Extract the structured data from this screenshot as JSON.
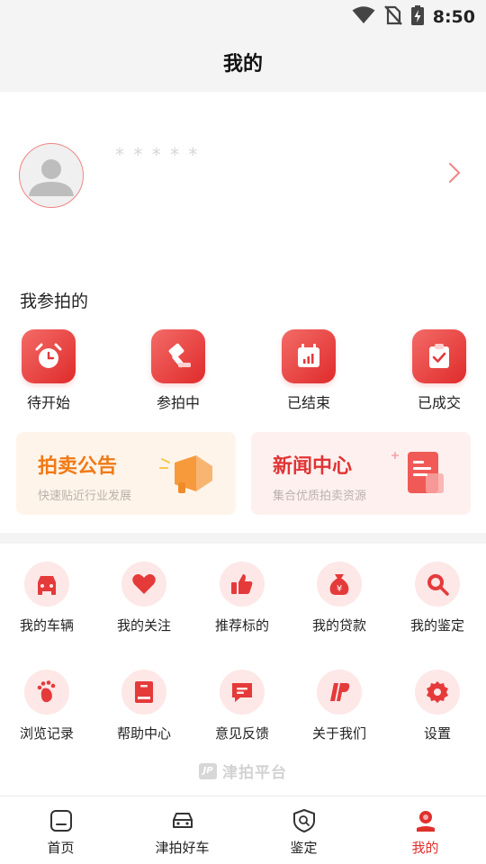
{
  "status_bar": {
    "time": "8:50"
  },
  "header": {
    "title": "我的"
  },
  "profile": {
    "username": "* * * * *"
  },
  "auction": {
    "section_title": "我参拍的",
    "statuses": [
      {
        "label": "待开始",
        "icon": "alarm-clock-icon"
      },
      {
        "label": "参拍中",
        "icon": "gavel-icon"
      },
      {
        "label": "已结束",
        "icon": "calendar-chart-icon"
      },
      {
        "label": "已成交",
        "icon": "clipboard-check-icon"
      }
    ]
  },
  "promos": [
    {
      "title": "拍卖公告",
      "subtitle": "快速贴近行业发展",
      "icon": "megaphone-icon"
    },
    {
      "title": "新闻中心",
      "subtitle": "集合优质拍卖资源",
      "icon": "newspaper-icon"
    }
  ],
  "menu": [
    {
      "label": "我的车辆",
      "icon": "car-icon"
    },
    {
      "label": "我的关注",
      "icon": "heart-icon"
    },
    {
      "label": "推荐标的",
      "icon": "thumbs-up-icon"
    },
    {
      "label": "我的贷款",
      "icon": "money-bag-icon"
    },
    {
      "label": "我的鉴定",
      "icon": "magnifier-icon"
    },
    {
      "label": "浏览记录",
      "icon": "footprint-icon"
    },
    {
      "label": "帮助中心",
      "icon": "book-icon"
    },
    {
      "label": "意见反馈",
      "icon": "chat-bubble-icon"
    },
    {
      "label": "关于我们",
      "icon": "brand-logo-icon"
    },
    {
      "label": "设置",
      "icon": "gear-icon"
    }
  ],
  "watermark": {
    "logo": "JP",
    "text": "津拍平台"
  },
  "tabs": [
    {
      "label": "首页",
      "icon": "home-icon"
    },
    {
      "label": "津拍好车",
      "icon": "car-outline-icon"
    },
    {
      "label": "鉴定",
      "icon": "shield-search-icon"
    },
    {
      "label": "我的",
      "icon": "user-icon",
      "active": true
    }
  ],
  "colors": {
    "accent": "#e0302c",
    "orange": "#f07a15",
    "tile_light": "#fde7e7"
  }
}
